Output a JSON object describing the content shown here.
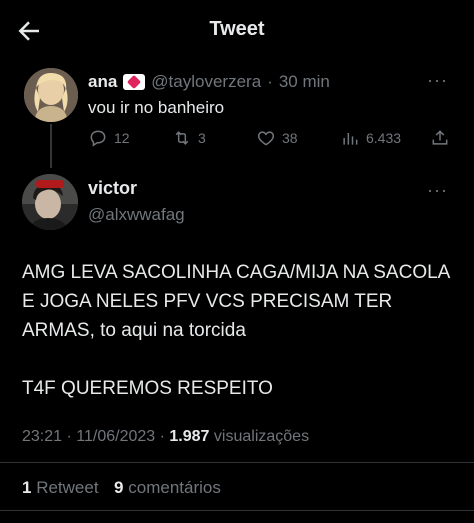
{
  "header": {
    "title": "Tweet",
    "back_icon": "arrow-left-icon"
  },
  "parent_tweet": {
    "name": "ana",
    "handle": "@tayloverzera",
    "separator": "·",
    "time": "30 min",
    "text": "vou ir no banheiro",
    "more": "···",
    "actions": {
      "replies": "12",
      "retweets": "3",
      "likes": "38",
      "views": "6.433"
    }
  },
  "main_tweet": {
    "name": "victor",
    "handle": "@alxwwafag",
    "more": "···",
    "text_paragraphs": [
      "AMG LEVA SACOLINHA CAGA/MIJA NA SACOLA E JOGA NELES PFV VCS PRECISAM TER ARMAS, to aqui na torcida",
      "T4F QUEREMOS RESPEITO"
    ],
    "time": "23:21",
    "date": "11/06/2023",
    "views_count": "1.987",
    "views_label": "visualizações",
    "retweets_count": "1",
    "retweets_label": "Retweet",
    "comments_count": "9",
    "comments_label": "comentários"
  },
  "colors": {
    "background": "#000000",
    "text": "#e7e9ea",
    "muted": "#71767b",
    "divider": "#2f3336"
  }
}
